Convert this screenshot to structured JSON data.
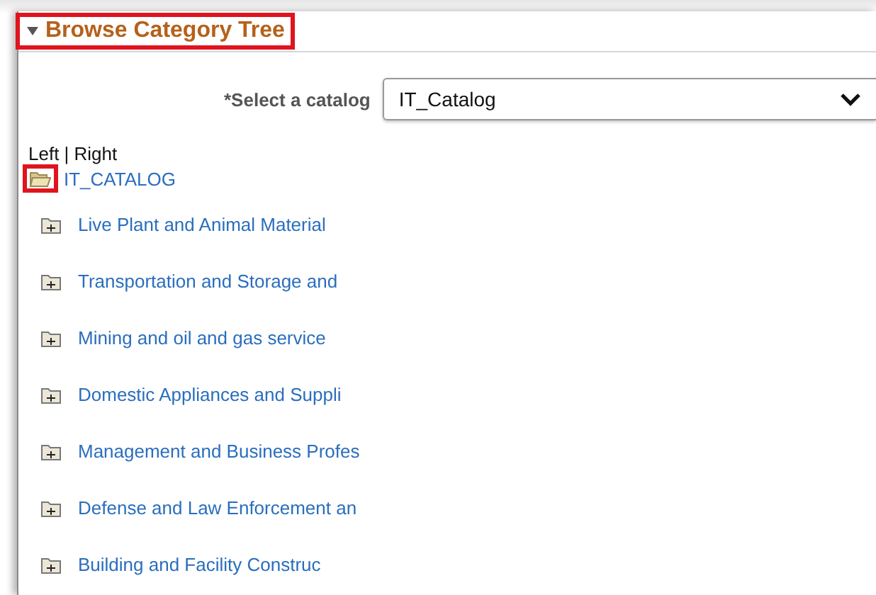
{
  "section": {
    "title": "Browse Category Tree",
    "expanded": true,
    "highlighted": true
  },
  "catalog_select": {
    "label": "*Select a catalog",
    "value": "IT_Catalog"
  },
  "view_links": "Left | Right",
  "tree": {
    "label": "IT_CATALOG",
    "expanded": true,
    "highlighted": true,
    "children": [
      {
        "label": "Live Plant and Animal Material",
        "expanded": false
      },
      {
        "label": "Transportation and Storage and",
        "expanded": false
      },
      {
        "label": "Mining and oil and gas service",
        "expanded": false
      },
      {
        "label": "Domestic Appliances and Suppli",
        "expanded": false
      },
      {
        "label": "Management and Business Profes",
        "expanded": false
      },
      {
        "label": "Defense and Law Enforcement an",
        "expanded": false
      },
      {
        "label": "Building and Facility Construc",
        "expanded": false
      }
    ]
  }
}
